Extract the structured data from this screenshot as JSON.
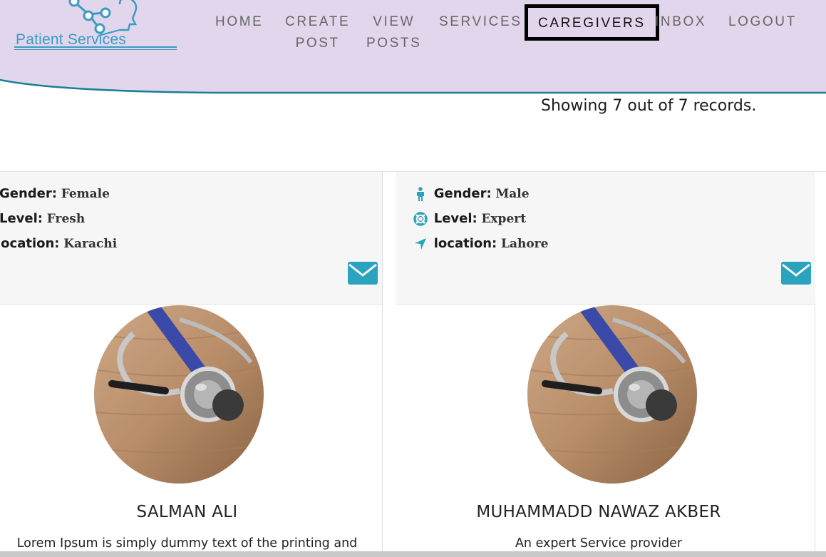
{
  "logo": {
    "text": "Patient Services"
  },
  "nav": {
    "home": "HOME",
    "create_1": "CREATE",
    "create_2": "POST",
    "view_1": "VIEW",
    "view_2": "POSTS",
    "services": "SERVICES",
    "caregivers": "CAREGIVERS",
    "inbox": "INBOX",
    "logout": "LOGOUT",
    "active": "CAREGIVERS"
  },
  "records_text": "Showing 7 out of 7 records.",
  "labels": {
    "gender": "Gender:",
    "level": "Level:",
    "location": "location:"
  },
  "cards": [
    {
      "gender": "Female",
      "level": "Fresh",
      "location": "Karachi",
      "name": "SALMAN ALI",
      "description": "Lorem Ipsum is simply dummy text of the printing and"
    },
    {
      "gender": "Male",
      "level": "Expert",
      "location": "Lahore",
      "name": "MUHAMMADD NAWAZ AKBER",
      "description": "An expert Service provider"
    }
  ],
  "icons": {
    "gender": "person-icon",
    "level": "life-ring-icon",
    "location": "location-arrow-icon",
    "message": "envelope-icon",
    "image": "stethoscope-image"
  },
  "colors": {
    "header_bg": "#e2d6ec",
    "accent": "#2aa3bf",
    "wave_line": "#1a7f94",
    "active_border": "#000000"
  }
}
